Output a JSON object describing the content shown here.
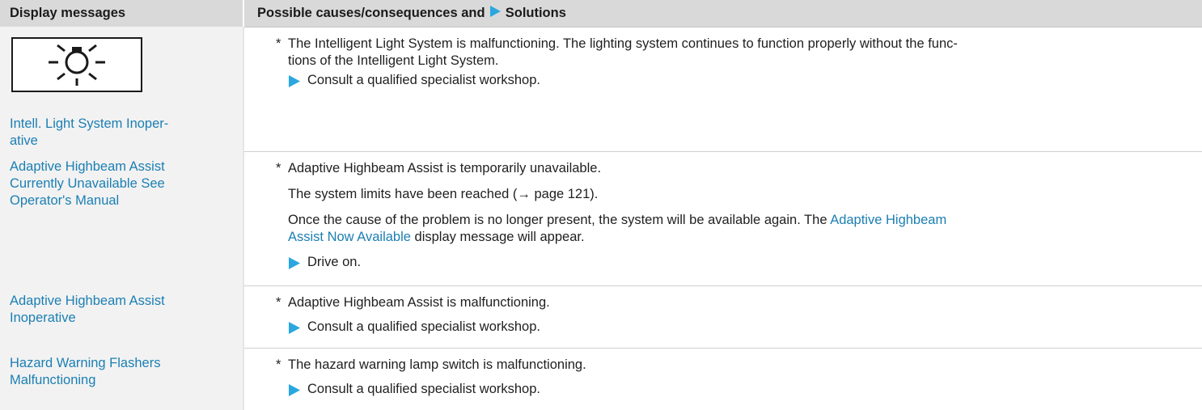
{
  "table": {
    "header": {
      "col1": "Display messages",
      "col2_prefix": "Possible causes/consequences and",
      "col2_suffix": "Solutions"
    },
    "rows": [
      {
        "icon": "light-bulb-icon",
        "message": "Intell. Light System Inoper-ative",
        "message_lines": [
          "Intell. Light System Inoper-",
          "ative"
        ],
        "cause_lines": [
          "The Intelligent Light System is malfunctioning. The lighting system continues to function properly without the func-",
          "tions of the Intelligent Light System."
        ],
        "solution": "Consult a qualified specialist workshop."
      },
      {
        "message_lines": [
          "Adaptive Highbeam Assist",
          "Currently Unavailable See",
          "Operator's Manual"
        ],
        "cause": "Adaptive Highbeam Assist is temporarily unavailable.",
        "limits": "The system limits have been reached (→ page 121).",
        "once_line1_prefix": "Once the cause of the problem is no longer present, the system will be available again. The",
        "once_line1_link": "Adaptive Highbeam",
        "once_line2_link": "Assist Now Available",
        "once_line2_suffix": "display message will appear.",
        "solution": "Drive on."
      },
      {
        "message_lines": [
          "Adaptive Highbeam Assist",
          "Inoperative"
        ],
        "cause": "Adaptive Highbeam Assist is malfunctioning.",
        "solution": "Consult a qualified specialist workshop."
      },
      {
        "message_lines": [
          "Hazard Warning Flashers",
          "Malfunctioning"
        ],
        "cause": "The hazard warning lamp switch is malfunctioning.",
        "solution": "Consult a qualified specialist workshop."
      }
    ],
    "bullet_symbol": "*"
  },
  "colors": {
    "link": "#1b7fb3",
    "solution_arrow": "#2aa7df",
    "header_bg": "#d9d9d9",
    "left_col_bg": "#f2f2f2"
  }
}
